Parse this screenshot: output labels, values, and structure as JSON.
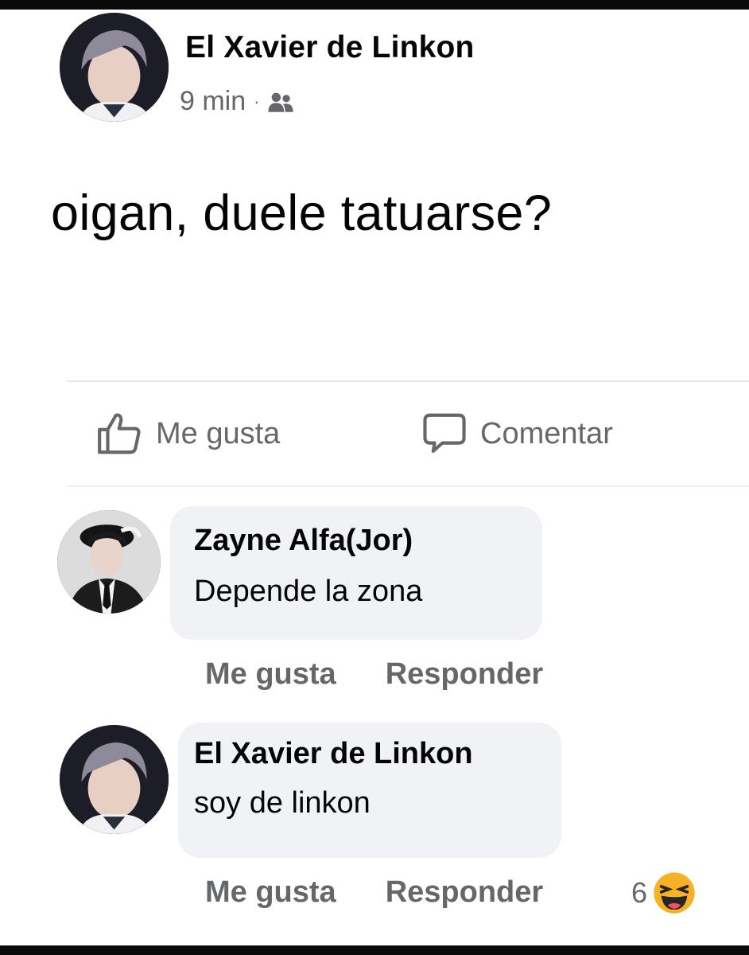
{
  "post": {
    "author": "El Xavier de Linkon",
    "time": "9 min",
    "separator": "·",
    "audience_icon": "friends-icon",
    "text": "oigan, duele tatuarse?"
  },
  "actions": {
    "like_label": "Me gusta",
    "comment_label": "Comentar"
  },
  "comments": [
    {
      "author": "Zayne Alfa(Jor)",
      "text": "Depende la zona",
      "like_label": "Me gusta",
      "reply_label": "Responder"
    },
    {
      "author": "El Xavier de Linkon",
      "text": "soy de linkon",
      "like_label": "Me gusta",
      "reply_label": "Responder",
      "reaction_count": "6",
      "reaction_icon": "haha-emoji-icon"
    }
  ],
  "colors": {
    "text": "#050505",
    "secondary": "#65676b",
    "bubble": "#f0f2f5",
    "divider": "#e4e6eb",
    "haha": "#f7b125"
  }
}
